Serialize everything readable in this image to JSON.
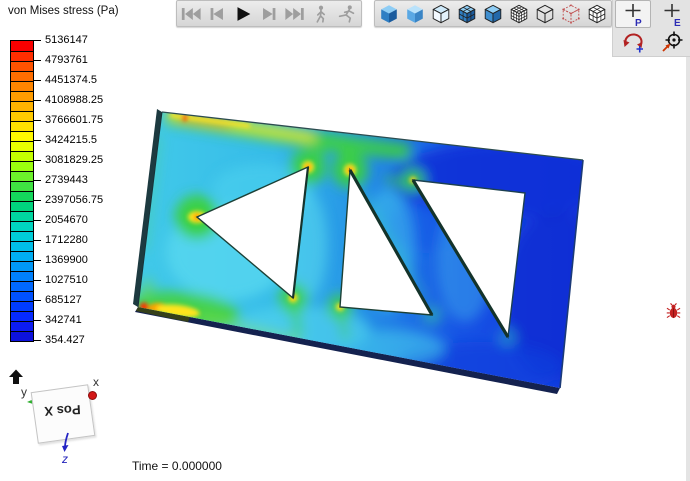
{
  "legend": {
    "title": "von Mises stress (Pa)",
    "tick_labels": [
      "5136147",
      "4793761",
      "4451374.5",
      "4108988.25",
      "3766601.75",
      "3424215.5",
      "3081829.25",
      "2739443",
      "2397056.75",
      "2054670",
      "1712280",
      "1369900",
      "1027510",
      "685127",
      "342741",
      "354.427"
    ],
    "colors_top_to_bottom": [
      "#fa0000",
      "#ff2e00",
      "#ff5200",
      "#ff6d00",
      "#ff8500",
      "#ff9c00",
      "#ffb300",
      "#ffca00",
      "#ffe100",
      "#fff800",
      "#e8ff00",
      "#c4ff00",
      "#9bff0e",
      "#6cf22b",
      "#3fe342",
      "#14d75c",
      "#00d47e",
      "#00d6a0",
      "#00d5c0",
      "#00cdd8",
      "#00bfe8",
      "#00adf2",
      "#0098f8",
      "#0080fc",
      "#0068ff",
      "#0051ff",
      "#003cff",
      "#062aff",
      "#0c1cf2",
      "#0d12dc"
    ]
  },
  "toolbars": {
    "playback": {
      "items": [
        {
          "name": "go-to-first-frame-button",
          "icon": "skip-start",
          "enabled": false
        },
        {
          "name": "previous-frame-button",
          "icon": "step-back",
          "enabled": false
        },
        {
          "name": "play-animation-button",
          "icon": "play",
          "enabled": true
        },
        {
          "name": "next-frame-button",
          "icon": "step-forward",
          "enabled": false
        },
        {
          "name": "go-to-last-frame-button",
          "icon": "skip-end",
          "enabled": false
        },
        {
          "name": "walk-mode-button",
          "icon": "walk-person",
          "enabled": false
        },
        {
          "name": "run-mode-button",
          "icon": "run-person",
          "enabled": false
        }
      ]
    },
    "display": {
      "items": [
        {
          "name": "shaded-view-button",
          "icon": "cube-solid"
        },
        {
          "name": "smooth-shaded-view-button",
          "icon": "cube-smooth"
        },
        {
          "name": "shaded-edges-view-button",
          "icon": "cube-edges-light"
        },
        {
          "name": "shaded-mesh-view-button",
          "icon": "cube-mesh-shaded"
        },
        {
          "name": "flat-shaded-view-button",
          "icon": "cube-solid-edges"
        },
        {
          "name": "fine-mesh-view-button",
          "icon": "cube-fine-mesh"
        },
        {
          "name": "wireframe-view-button",
          "icon": "cube-wireframe"
        },
        {
          "name": "feature-edge-view-button",
          "icon": "cube-wire-red-dashed"
        },
        {
          "name": "coarse-mesh-view-button",
          "icon": "cube-mesh-plain"
        }
      ]
    },
    "pick": {
      "items": [
        {
          "name": "pick-point-button",
          "icon": "crosshair-letter",
          "label": "P",
          "active": true
        },
        {
          "name": "pick-element-button",
          "icon": "crosshair-letter",
          "label": "E"
        },
        {
          "name": "rotate-view-button",
          "icon": "rotate"
        },
        {
          "name": "center-of-rotation-button",
          "icon": "center-target"
        }
      ]
    }
  },
  "triad": {
    "x_label": "x",
    "y_label": "y",
    "z_label": "z",
    "plane_label": "Pos X"
  },
  "status": {
    "time": "Time = 0.000000"
  }
}
